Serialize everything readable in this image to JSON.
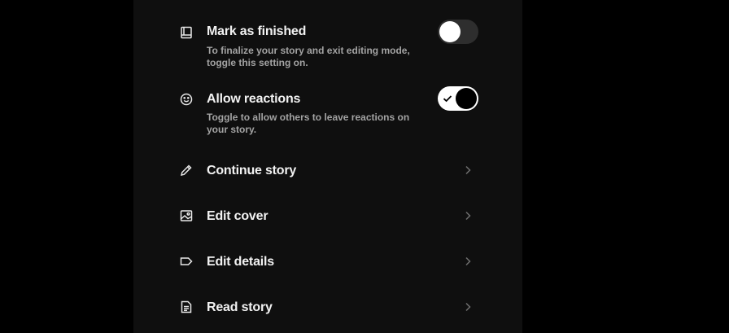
{
  "colors": {
    "page_background": "#000000",
    "panel_background": "#0f0f0f",
    "title_text": "#f2f2f2",
    "description_text": "#a3a3a3",
    "toggle_off_track": "#2e2e2e",
    "toggle_on_track": "#ffffff",
    "chevron": "#6e6e6e"
  },
  "settings": {
    "mark_finished": {
      "icon": "book-icon",
      "title": "Mark as finished",
      "description": "To finalize your story and exit editing mode, toggle this setting on.",
      "enabled": false
    },
    "allow_reactions": {
      "icon": "smiley-icon",
      "title": "Allow reactions",
      "description": "Toggle to allow others to leave reactions on your story.",
      "enabled": true
    }
  },
  "actions": {
    "continue_story": {
      "icon": "pencil-icon",
      "label": "Continue story"
    },
    "edit_cover": {
      "icon": "image-icon",
      "label": "Edit cover"
    },
    "edit_details": {
      "icon": "tag-icon",
      "label": "Edit details"
    },
    "read_story": {
      "icon": "document-icon",
      "label": "Read story"
    }
  }
}
